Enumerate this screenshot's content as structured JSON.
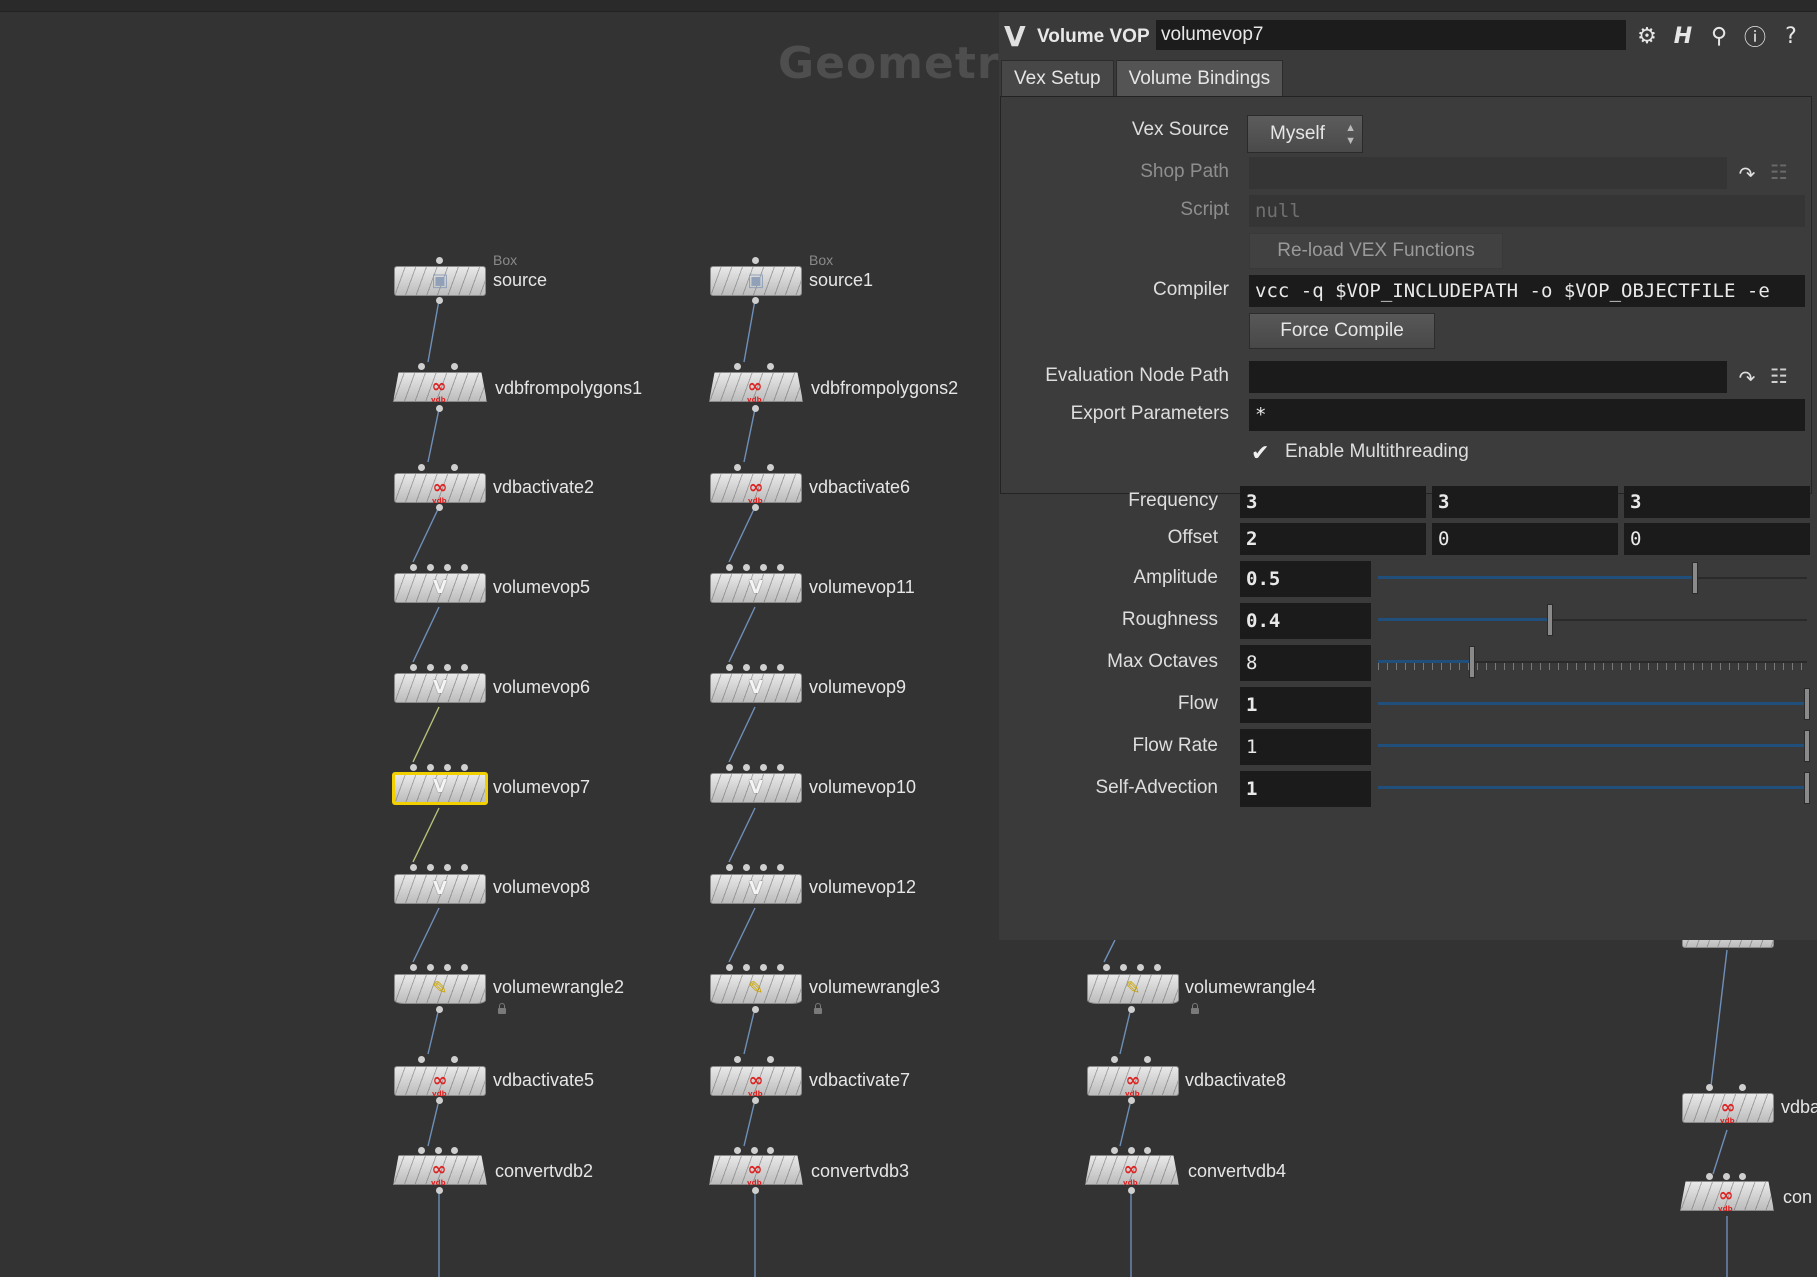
{
  "network": {
    "title": "Geometry"
  },
  "nodes": {
    "source": {
      "name": "source",
      "type": "Box"
    },
    "source1": {
      "name": "source1",
      "type": "Box"
    },
    "vdbfrompolygons1": "vdbfrompolygons1",
    "vdbfrompolygons2": "vdbfrompolygons2",
    "vdbactivate2": "vdbactivate2",
    "vdbactivate6": "vdbactivate6",
    "volumevop5": "volumevop5",
    "volumevop11": "volumevop11",
    "volumevop6": "volumevop6",
    "volumevop9": "volumevop9",
    "volumevop7": "volumevop7",
    "volumevop10": "volumevop10",
    "volumevop8": "volumevop8",
    "volumevop12": "volumevop12",
    "volumewrangle2": "volumewrangle2",
    "volumewrangle3": "volumewrangle3",
    "volumewrangle4": "volumewrangle4",
    "vdbactivate5": "vdbactivate5",
    "vdbactivate7": "vdbactivate7",
    "vdbactivate8": "vdbactivate8",
    "convertvdb2": "convertvdb2",
    "convertvdb3": "convertvdb3",
    "convertvdb4": "convertvdb4",
    "partial_vdba": "vdba",
    "partial_con": "con"
  },
  "panel": {
    "operator_type": "Volume VOP",
    "node_name": "volumevop7",
    "tabs": [
      "Vex Setup",
      "Volume Bindings"
    ],
    "vex_source": {
      "label": "Vex Source",
      "value": "Myself"
    },
    "shop_path": {
      "label": "Shop Path",
      "value": ""
    },
    "script": {
      "label": "Script",
      "value": "null"
    },
    "reload_button": "Re-load VEX Functions",
    "compiler": {
      "label": "Compiler",
      "value": "vcc -q $VOP_INCLUDEPATH -o $VOP_OBJECTFILE -e"
    },
    "force_compile_button": "Force Compile",
    "eval_node_path": {
      "label": "Evaluation Node Path",
      "value": ""
    },
    "export_params": {
      "label": "Export Parameters",
      "value": "*"
    },
    "multithreading": {
      "label": "Enable Multithreading",
      "checked": true
    },
    "frequency": {
      "label": "Frequency",
      "values": [
        "3",
        "3",
        "3"
      ]
    },
    "offset": {
      "label": "Offset",
      "values": [
        "2",
        "0",
        "0"
      ]
    },
    "amplitude": {
      "label": "Amplitude",
      "value": "0.5",
      "slider_fraction": 0.74
    },
    "roughness": {
      "label": "Roughness",
      "value": "0.4",
      "slider_fraction": 0.4
    },
    "max_octaves": {
      "label": "Max Octaves",
      "value": "8",
      "slider_fraction": 0.22
    },
    "flow": {
      "label": "Flow",
      "value": "1",
      "slider_fraction": 1.0
    },
    "flow_rate": {
      "label": "Flow Rate",
      "value": "1",
      "slider_fraction": 1.0
    },
    "self_advection": {
      "label": "Self-Advection",
      "value": "1",
      "slider_fraction": 1.0
    }
  },
  "icons": {
    "panel_logo": "volume-vop-icon",
    "toolbar": [
      "gear-icon",
      "houdini-help-icon",
      "search-icon",
      "info-icon",
      "help-icon"
    ]
  },
  "colors": {
    "selected_node": "#f2d000",
    "wire": "#6f8fb8",
    "slider_fill": "#1f4f7a"
  }
}
